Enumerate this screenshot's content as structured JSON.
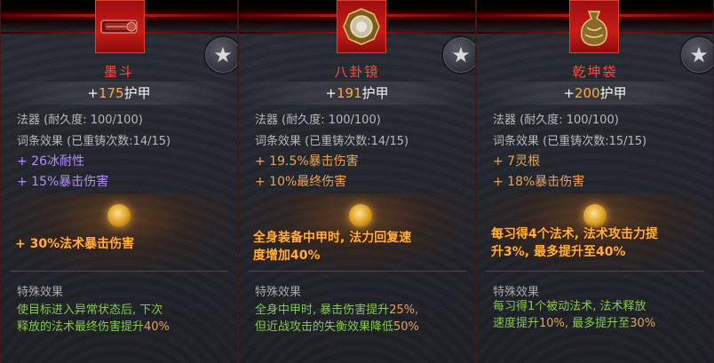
{
  "cards": [
    {
      "name": "墨斗",
      "stat_prefix": "+",
      "stat_value": "175",
      "stat_suffix": "护甲",
      "type_line": "法器  (耐久度: 100/100)",
      "affix_line": "词条效果  (已重铸次数:14/15)",
      "affixes": [
        "+ 26冰耐性",
        "+ 15%暴击伤害"
      ],
      "affix_colors": [
        "purple",
        "purple"
      ],
      "ability": [
        "+ 30%法术暴击伤害"
      ],
      "special_title": "特殊效果",
      "special": [
        "使目标进入异常状态后, 下次",
        "释放的法术最终伤害提升40%"
      ]
    },
    {
      "name": "八卦镜",
      "stat_prefix": "+",
      "stat_value": "191",
      "stat_suffix": "护甲",
      "type_line": "法器  (耐久度: 100/100)",
      "affix_line": "词条效果  (已重铸次数:14/15)",
      "affixes": [
        "+ 19.5%暴击伤害",
        "+ 10%最终伤害"
      ],
      "affix_colors": [
        "orange",
        "orange"
      ],
      "ability": [
        "全身装备中甲时, 法力回复速",
        "度增加40%"
      ],
      "special_title": "特殊效果",
      "special": [
        "全身中甲时, 暴击伤害提升25%,",
        "但近战攻击的失衡效果降低50%"
      ]
    },
    {
      "name": "乾坤袋",
      "stat_prefix": "+",
      "stat_value": "200",
      "stat_suffix": "护甲",
      "type_line": "法器  (耐久度: 100/100)",
      "affix_line": "词条效果  (已重铸次数:15/15)",
      "affixes": [
        "+ 7灵根",
        "+ 18%暴击伤害"
      ],
      "affix_colors": [
        "orange",
        "orange"
      ],
      "ability": [
        "每习得4个法术, 法术攻击力提",
        "升3%, 最多提升至40%"
      ],
      "special_title": "特殊效果",
      "special": [
        "每习得1个被动法术, 法术释放",
        "速度提升10%, 最多提升至30%"
      ]
    }
  ],
  "icons": [
    "ink-line-tool-icon",
    "bagua-mirror-icon",
    "qiankun-bag-icon"
  ],
  "colors": {
    "name": "#ff4a3a",
    "stat_number": "#ffa640",
    "special": "#86c84a",
    "ability": "#ffb040",
    "purple_affix": "#b58cff",
    "orange_affix": "#e8a258"
  }
}
